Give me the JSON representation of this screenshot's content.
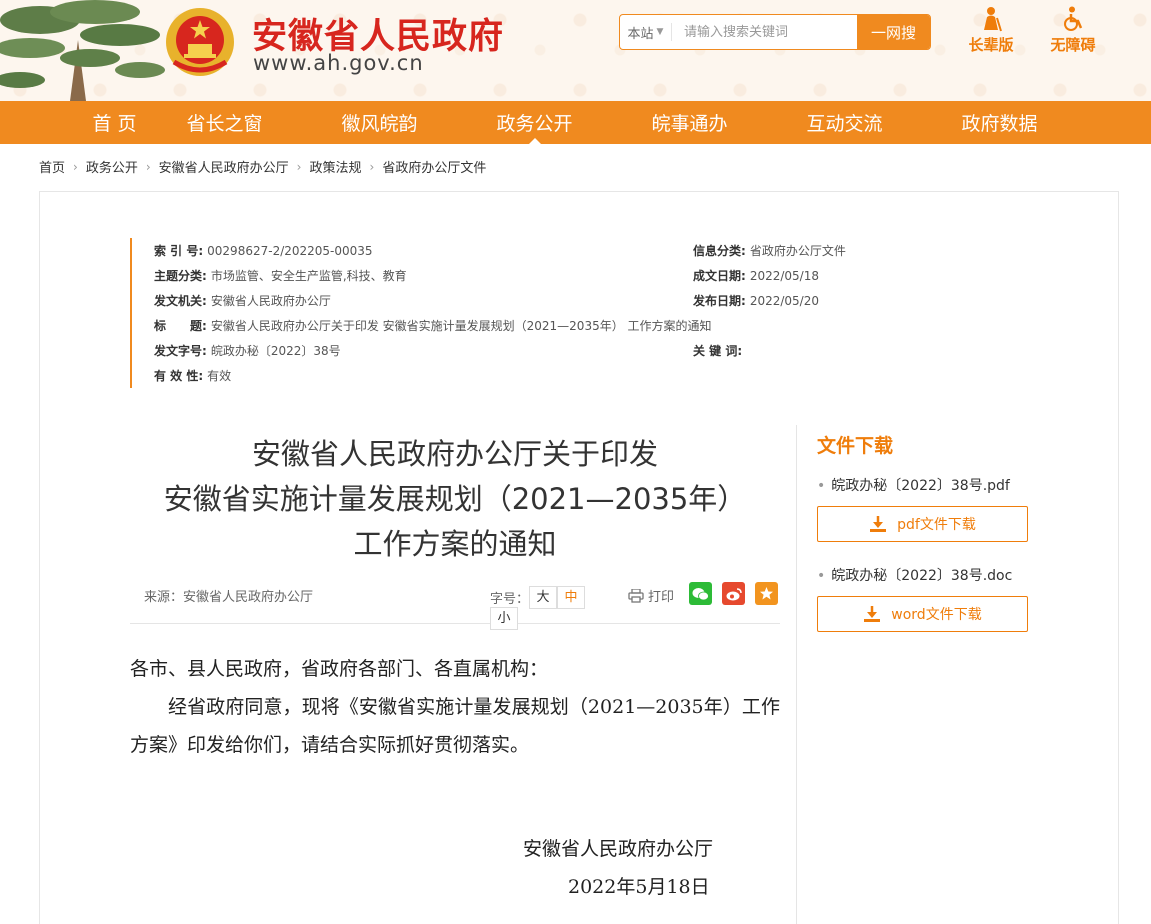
{
  "header": {
    "site_name": "安徽省人民政府",
    "site_domain": "www.ah.gov.cn",
    "search": {
      "scope": "本站",
      "placeholder": "请输入搜索关键词",
      "button": "一网搜"
    },
    "elder_mode": "长辈版",
    "accessibility": "无障碍"
  },
  "nav": {
    "items": [
      {
        "label": "首 页"
      },
      {
        "label": "省长之窗"
      },
      {
        "label": "徽风皖韵"
      },
      {
        "label": "政务公开"
      },
      {
        "label": "皖事通办"
      },
      {
        "label": "互动交流"
      },
      {
        "label": "政府数据"
      }
    ],
    "active": "政务公开"
  },
  "breadcrumb": [
    "首页",
    "政务公开",
    "安徽省人民政府办公厅",
    "政策法规",
    "省政府办公厅文件"
  ],
  "meta": {
    "index_label": "索 引 号:",
    "index_value": "00298627-2/202205-00035",
    "info_class_label": "信息分类:",
    "info_class_value": "省政府办公厅文件",
    "topic_label": "主题分类:",
    "topic_value": "市场监管、安全生产监管,科技、教育",
    "written_date_label": "成文日期:",
    "written_date_value": "2022/05/18",
    "issuer_label": "发文机关:",
    "issuer_value": "安徽省人民政府办公厅",
    "publish_date_label": "发布日期:",
    "publish_date_value": "2022/05/20",
    "title_label": "标　　题:",
    "title_value": "安徽省人民政府办公厅关于印发 安徽省实施计量发展规划（2021—2035年） 工作方案的通知",
    "doc_no_label": "发文字号:",
    "doc_no_value": "皖政办秘〔2022〕38号",
    "keywords_label": "关 键 词:",
    "keywords_value": "",
    "validity_label": "有 效 性:",
    "validity_value": "有效"
  },
  "document": {
    "title_lines": [
      "安徽省人民政府办公厅关于印发",
      "安徽省实施计量发展规划（2021—2035年）",
      "工作方案的通知"
    ],
    "source": "来源：安徽省人民政府办公厅",
    "font_size_label": "字号：",
    "font_sizes": [
      "大",
      "中",
      "小"
    ],
    "print_label": "打印",
    "salutation": "各市、县人民政府，省政府各部门、各直属机构：",
    "body": "经省政府同意，现将《安徽省实施计量发展规划（2021—2035年）工作方案》印发给你们，请结合实际抓好贯彻落实。",
    "signature_org": "安徽省人民政府办公厅",
    "signature_date": "2022年5月18日"
  },
  "downloads": {
    "title": "文件下载",
    "files": [
      {
        "name": "皖政办秘〔2022〕38号.pdf",
        "button": "pdf文件下载"
      },
      {
        "name": "皖政办秘〔2022〕38号.doc",
        "button": "word文件下载"
      }
    ]
  },
  "colors": {
    "accent": "#f08a1f",
    "title_red": "#d7261e",
    "wechat": "#2dbb37",
    "weibo": "#e6492e",
    "favorite": "#f2941f"
  },
  "icons": [
    "tree-icon",
    "national-emblem-icon",
    "elder-icon",
    "wheelchair-icon",
    "printer-icon",
    "wechat-icon",
    "weibo-icon",
    "favorite-icon",
    "download-icon"
  ]
}
